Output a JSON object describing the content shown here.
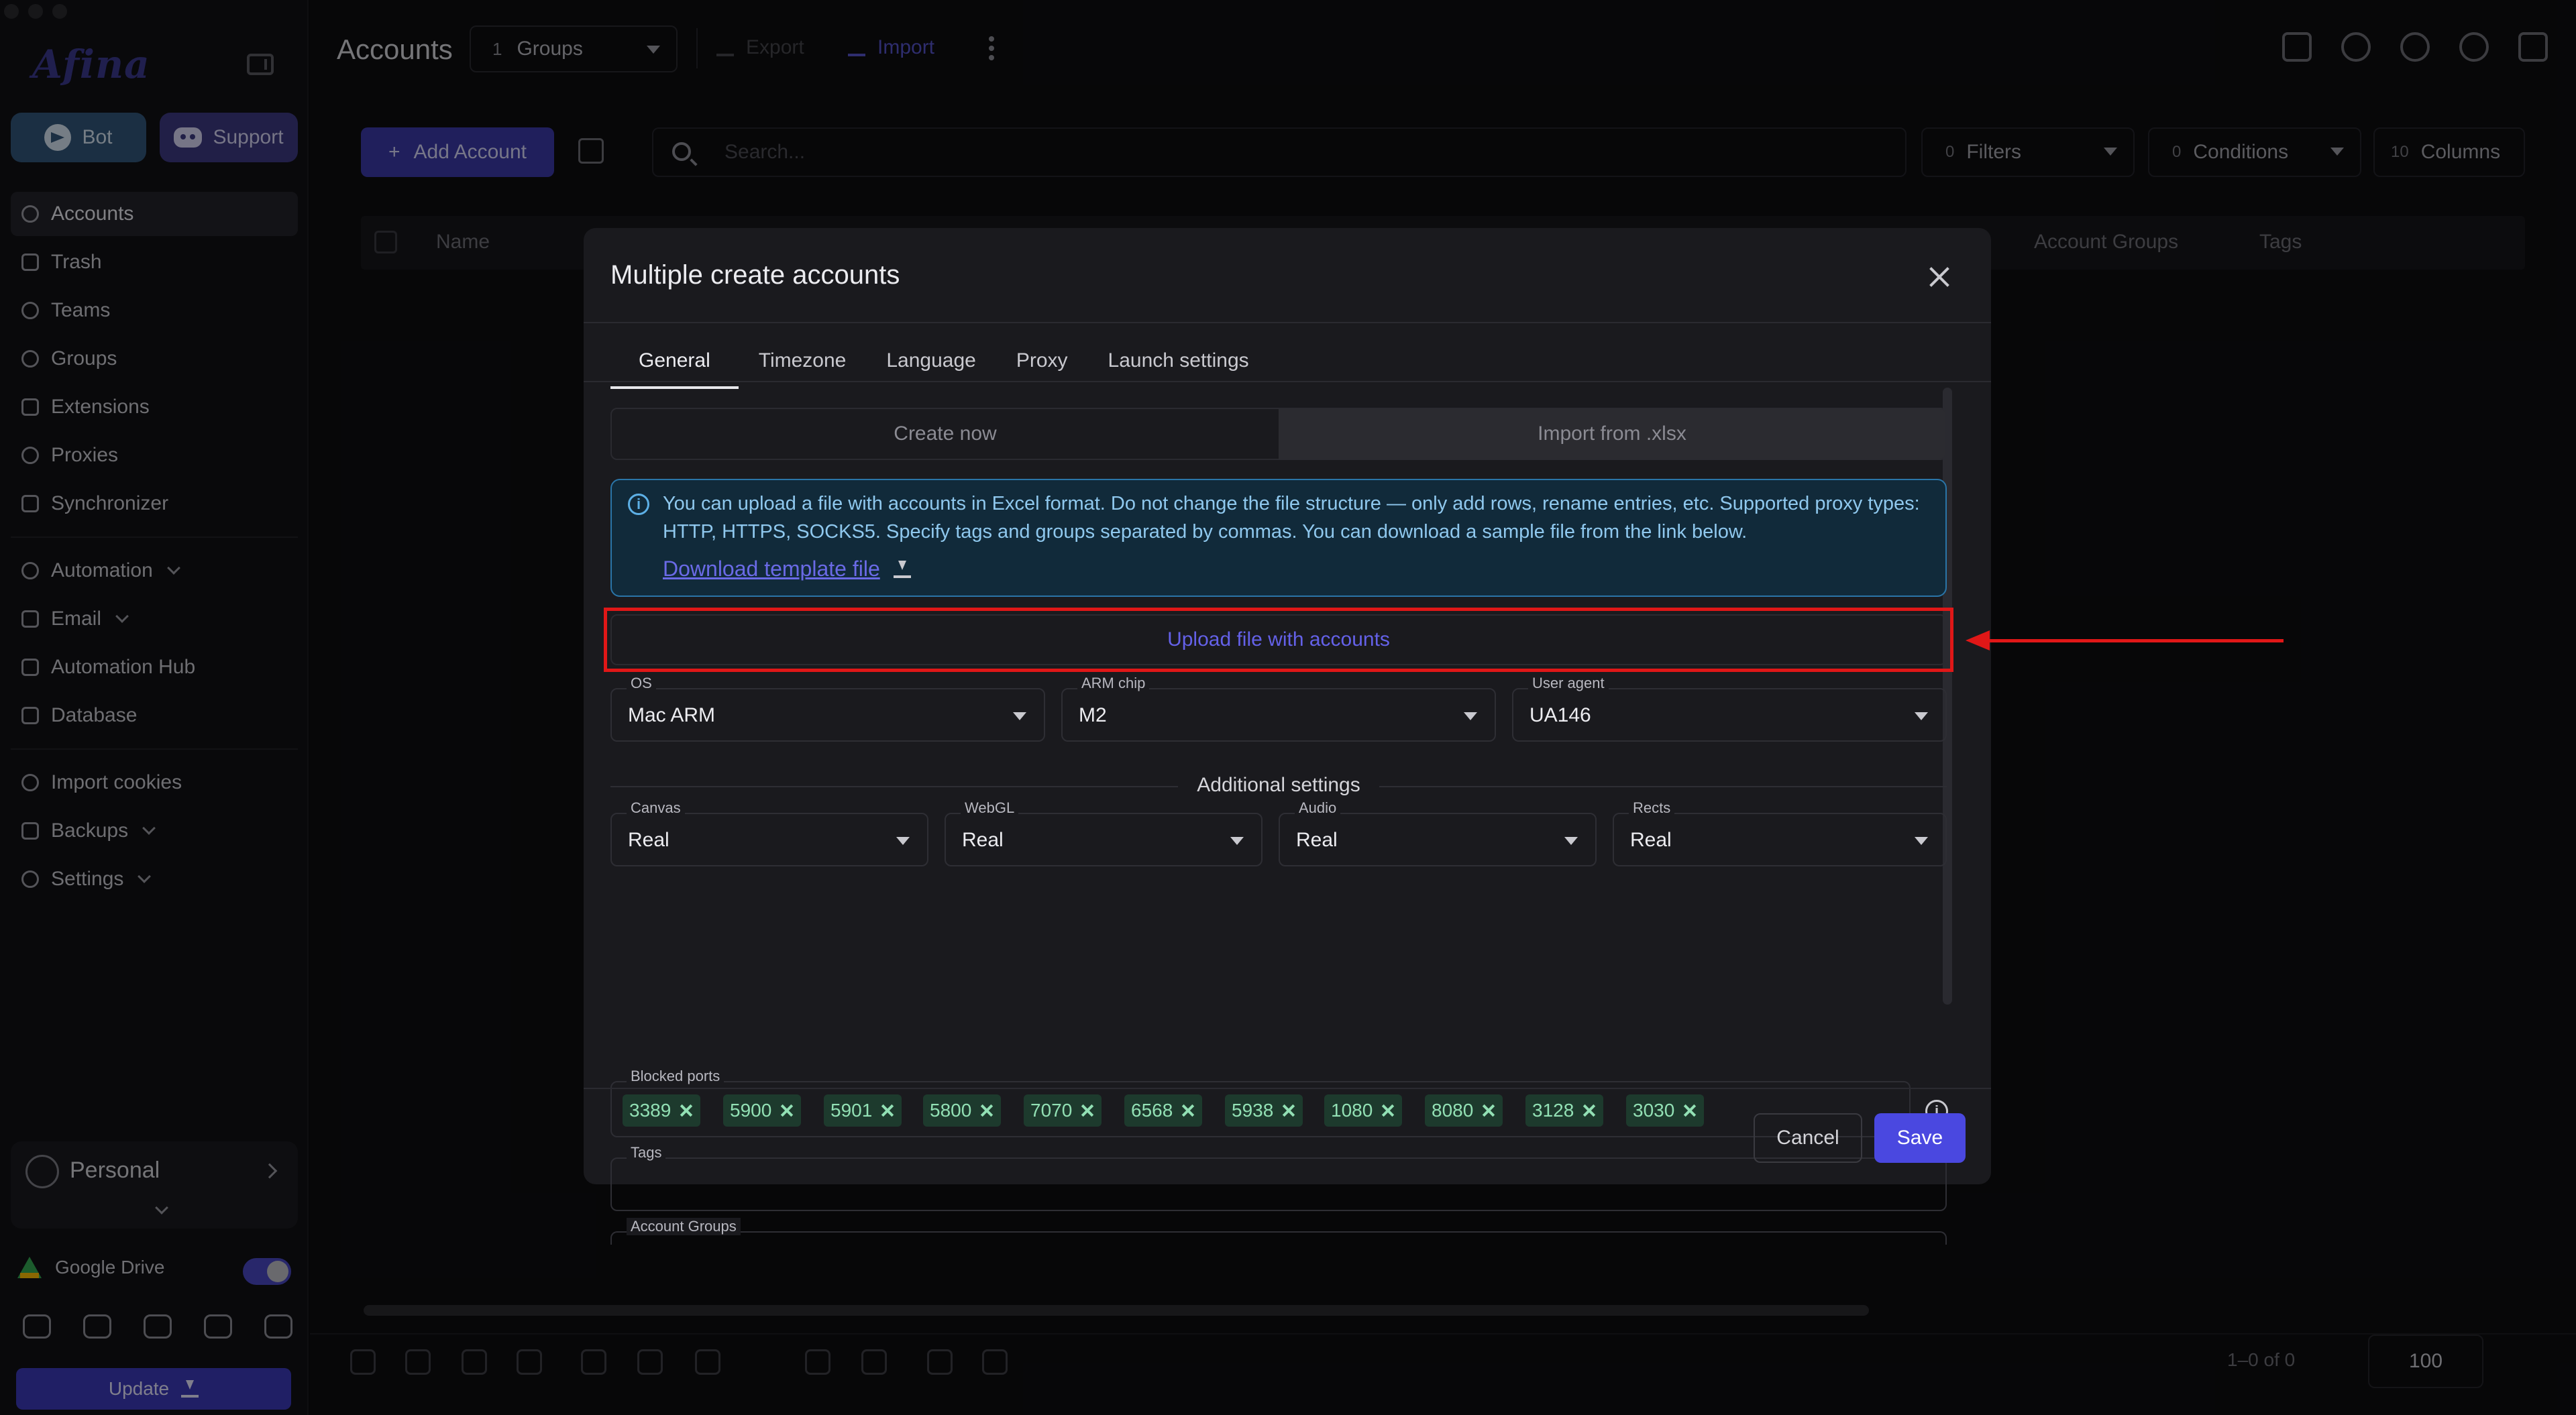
{
  "sidebar": {
    "logo": "Afina",
    "bot_label": "Bot",
    "support_label": "Support",
    "items": [
      {
        "label": "Accounts"
      },
      {
        "label": "Trash"
      },
      {
        "label": "Teams"
      },
      {
        "label": "Groups"
      },
      {
        "label": "Extensions"
      },
      {
        "label": "Proxies"
      },
      {
        "label": "Synchronizer"
      },
      {
        "label": "Automation"
      },
      {
        "label": "Email"
      },
      {
        "label": "Automation Hub"
      },
      {
        "label": "Database"
      },
      {
        "label": "Import cookies"
      },
      {
        "label": "Backups"
      },
      {
        "label": "Settings"
      }
    ],
    "workspace": "Personal",
    "google_drive": "Google Drive",
    "update_label": "Update"
  },
  "header": {
    "title": "Accounts",
    "groups_count": "1",
    "groups_label": "Groups",
    "export_label": "Export",
    "import_label": "Import"
  },
  "toolbar": {
    "add_account": "Add Account",
    "search_placeholder": "Search...",
    "filters_count": "0",
    "filters_label": "Filters",
    "conditions_count": "0",
    "conditions_label": "Conditions",
    "columns_count": "10",
    "columns_label": "Columns"
  },
  "table": {
    "headers": [
      "Name",
      "Account Groups",
      "Tags"
    ]
  },
  "footer": {
    "pagination": "1–0 of 0",
    "per_page": "100"
  },
  "modal": {
    "title": "Multiple create accounts",
    "tabs": [
      "General",
      "Timezone",
      "Language",
      "Proxy",
      "Launch settings"
    ],
    "segments": [
      "Create now",
      "Import from .xlsx"
    ],
    "info_text": "You can upload a file with accounts in Excel format. Do not change the file structure — only add rows, rename entries, etc. Supported proxy types: HTTP, HTTPS, SOCKS5. Specify tags and groups separated by commas. You can download a sample file from the link below.",
    "download_link": "Download template file",
    "upload_label": "Upload file with accounts",
    "os": {
      "label": "OS",
      "value": "Mac ARM"
    },
    "arm_chip": {
      "label": "ARM chip",
      "value": "M2"
    },
    "user_agent": {
      "label": "User agent",
      "value": "UA146"
    },
    "additional_settings": "Additional settings",
    "canvas": {
      "label": "Canvas",
      "value": "Real"
    },
    "webgl": {
      "label": "WebGL",
      "value": "Real"
    },
    "audio": {
      "label": "Audio",
      "value": "Real"
    },
    "rects": {
      "label": "Rects",
      "value": "Real"
    },
    "blocked_ports_label": "Blocked ports",
    "blocked_ports": [
      "3389",
      "5900",
      "5901",
      "5800",
      "7070",
      "6568",
      "5938",
      "1080",
      "8080",
      "3128",
      "3030"
    ],
    "tags_label": "Tags",
    "account_groups_label": "Account Groups",
    "cancel_label": "Cancel",
    "save_label": "Save"
  },
  "colors": {
    "accent": "#4a48e0",
    "highlight": "#e01717",
    "chip_bg": "#1d3a2d",
    "info_border": "#2a75a8"
  }
}
